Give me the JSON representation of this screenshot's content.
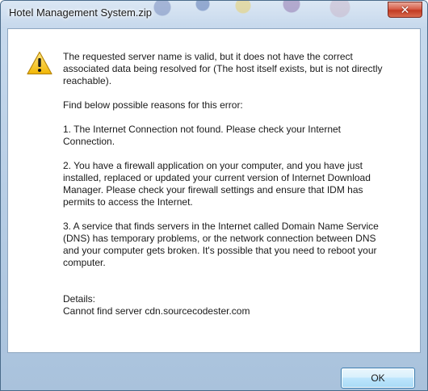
{
  "window": {
    "title": "Hotel Management System.zip",
    "close_label": "✕"
  },
  "icon": {
    "name": "warning-icon",
    "color": "#f5c518"
  },
  "message": {
    "p1": "The requested server name is valid, but it does not have the correct associated data being resolved for (The host itself exists, but is not directly reachable).",
    "p2": "Find below possible reasons for this error:",
    "p3": "1. The Internet Connection not found. Please check your Internet Connection.",
    "p4": "2. You have a firewall application on your computer, and you have just installed, replaced or updated your current version of Internet Download Manager. Please check your firewall settings and ensure that IDM has permits to access the Internet.",
    "p5": "3. A service that finds servers in the Internet called Domain Name Service (DNS) has temporary problems, or the network connection between DNS and your computer gets broken. It's possible that you need to reboot your computer.",
    "details_label": "Details:",
    "details_value": "Cannot find server cdn.sourcecodester.com"
  },
  "footer": {
    "ok_label": "OK"
  }
}
